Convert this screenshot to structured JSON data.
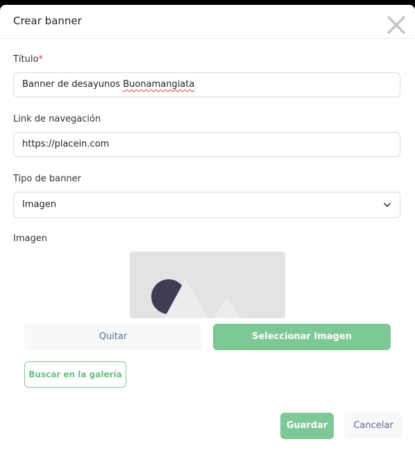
{
  "modal": {
    "title": "Crear banner"
  },
  "form": {
    "title": {
      "label": "Título",
      "required_mark": "*",
      "value_prefix": "Banner de desayunos ",
      "value_misspelled": "Buonamangiata"
    },
    "link": {
      "label": "Link de navegación",
      "value": "https://placein.com"
    },
    "banner_type": {
      "label": "Tipo de banner",
      "selected": "Imagen"
    },
    "image": {
      "label": "Imagen"
    }
  },
  "buttons": {
    "remove": "Quitar",
    "select_image": "Seleccionar Imagen",
    "gallery": "Buscar en la galería",
    "save": "Guardar",
    "cancel": "Cancelar"
  },
  "colors": {
    "accent": "#7ec895",
    "required": "#e53935",
    "placeholder_bg": "#e3e3e3",
    "placeholder_sun": "#3f3d56"
  },
  "icons": {
    "close": "close-icon",
    "dropdown": "chevron-down-icon",
    "image_placeholder": "image-placeholder-icon"
  }
}
